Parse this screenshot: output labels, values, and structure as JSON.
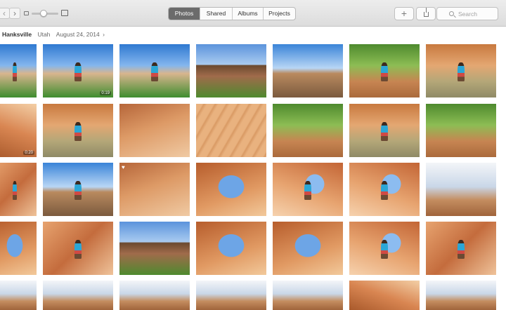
{
  "toolbar": {
    "tabs": [
      {
        "label": "Photos",
        "active": true
      },
      {
        "label": "Shared",
        "active": false
      },
      {
        "label": "Albums",
        "active": false
      },
      {
        "label": "Projects",
        "active": false
      }
    ],
    "add_label": "+",
    "search_placeholder": "Search",
    "icons": [
      "back-icon",
      "forward-icon",
      "zoom-small-icon",
      "zoom-large-icon",
      "add-icon",
      "share-icon",
      "search-icon"
    ],
    "zoom_level": 0.45
  },
  "moment": {
    "title": "Hanksville",
    "location": "Utah",
    "date": "August 24, 2014",
    "chevron": "›"
  },
  "photos": [
    {
      "row": 1,
      "col": 1,
      "scene": "rider-on-horse"
    },
    {
      "row": 1,
      "col": 2,
      "scene": "rider-on-horse",
      "duration": "0:19"
    },
    {
      "row": 1,
      "col": 3,
      "scene": "rider-on-horse"
    },
    {
      "row": 1,
      "col": 4,
      "scene": "canyon-overlook"
    },
    {
      "row": 1,
      "col": 5,
      "scene": "desert-buttes"
    },
    {
      "row": 1,
      "col": 6,
      "scene": "portrait-boy"
    },
    {
      "row": 1,
      "col": 7,
      "scene": "stream-hike"
    },
    {
      "row": 2,
      "col": 1,
      "scene": "waterfall",
      "duration": "0:20"
    },
    {
      "row": 2,
      "col": 2,
      "scene": "waterfall-swim"
    },
    {
      "row": 2,
      "col": 3,
      "scene": "red-rock-stream"
    },
    {
      "row": 2,
      "col": 4,
      "scene": "sandstone-texture"
    },
    {
      "row": 2,
      "col": 5,
      "scene": "creek-oasis"
    },
    {
      "row": 2,
      "col": 6,
      "scene": "creek-play"
    },
    {
      "row": 2,
      "col": 7,
      "scene": "creek-oasis"
    },
    {
      "row": 3,
      "col": 1,
      "scene": "canyon-rider"
    },
    {
      "row": 3,
      "col": 2,
      "scene": "desert-duo"
    },
    {
      "row": 3,
      "col": 3,
      "scene": "slickrock",
      "favorite": true
    },
    {
      "row": 3,
      "col": 4,
      "scene": "arch"
    },
    {
      "row": 3,
      "col": 5,
      "scene": "arch-person"
    },
    {
      "row": 3,
      "col": 6,
      "scene": "arch-selfie"
    },
    {
      "row": 3,
      "col": 7,
      "scene": "cloudy-cliffs"
    },
    {
      "row": 4,
      "col": 1,
      "scene": "arch",
      "favorite": true
    },
    {
      "row": 4,
      "col": 2,
      "scene": "couple-selfie"
    },
    {
      "row": 4,
      "col": 3,
      "scene": "rock-climb"
    },
    {
      "row": 4,
      "col": 4,
      "scene": "arch"
    },
    {
      "row": 4,
      "col": 5,
      "scene": "arch-hike"
    },
    {
      "row": 4,
      "col": 6,
      "scene": "arch-person"
    },
    {
      "row": 4,
      "col": 7,
      "scene": "couple-selfie"
    },
    {
      "row": 5,
      "col": 1,
      "scene": "cloudy-cliffs"
    },
    {
      "row": 5,
      "col": 2,
      "scene": "cloud"
    },
    {
      "row": 5,
      "col": 3,
      "scene": "cloud"
    },
    {
      "row": 5,
      "col": 4,
      "scene": "cloud"
    },
    {
      "row": 5,
      "col": 5,
      "scene": "cloud"
    },
    {
      "row": 5,
      "col": 6,
      "scene": "canyon"
    },
    {
      "row": 5,
      "col": 7,
      "scene": "cloud"
    }
  ]
}
